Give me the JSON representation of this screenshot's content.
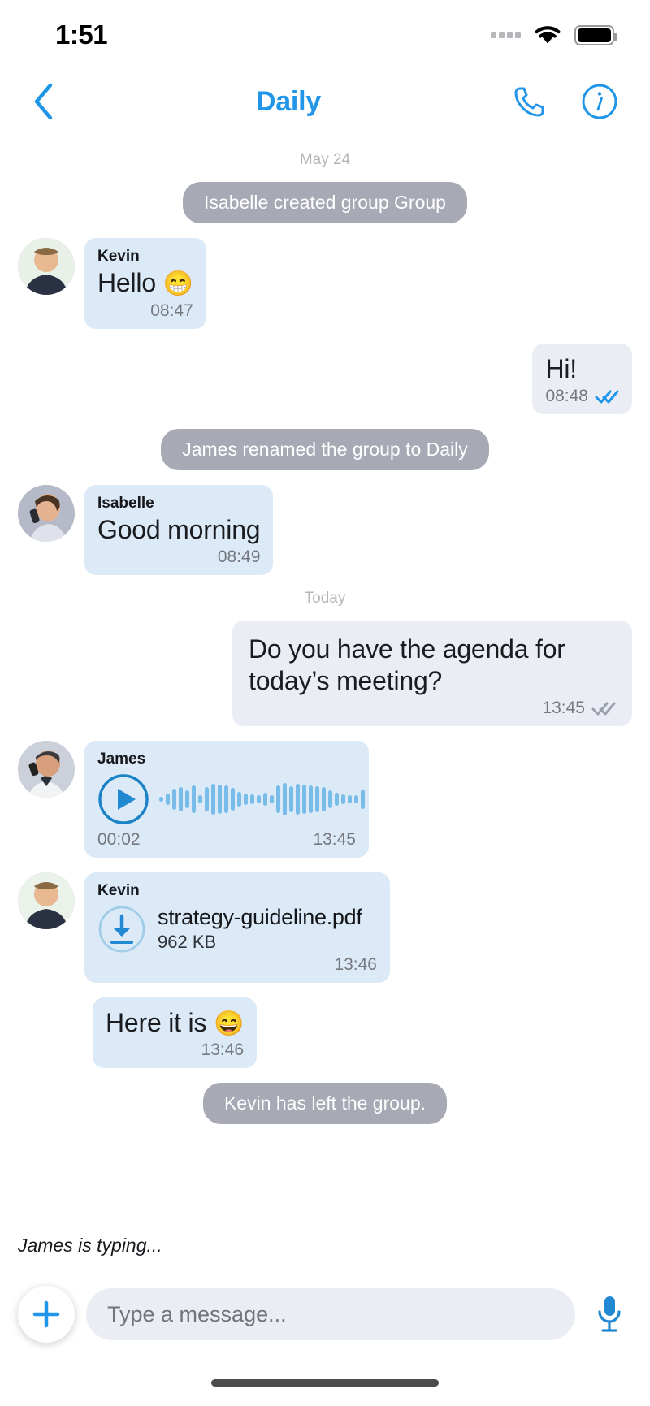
{
  "status_bar": {
    "time": "1:51",
    "signal_icon": "signal-dots-icon",
    "wifi_icon": "wifi-icon",
    "battery_icon": "battery-icon"
  },
  "nav": {
    "back_icon": "chevron-left-icon",
    "title": "Daily",
    "call_icon": "phone-icon",
    "info_icon": "info-circle-icon"
  },
  "chat": {
    "day_separators": {
      "first": "May 24",
      "second": "Today"
    },
    "system_messages": {
      "created": "Isabelle created group Group",
      "renamed": "James renamed the group to Daily",
      "left": "Kevin has left the group."
    },
    "messages": [
      {
        "id": "kevin-hello",
        "sender": "Kevin",
        "text": "Hello",
        "emoji": "😁",
        "time": "08:47",
        "direction": "in",
        "type": "text"
      },
      {
        "id": "me-hi",
        "sender": "",
        "text": "Hi!",
        "time": "08:48",
        "direction": "out",
        "type": "text",
        "status": "read"
      },
      {
        "id": "isabelle-good-morning",
        "sender": "Isabelle",
        "text": "Good morning",
        "time": "08:49",
        "direction": "in",
        "type": "text"
      },
      {
        "id": "me-agenda",
        "sender": "",
        "text": "Do you have the agenda for today’s meeting?",
        "time": "13:45",
        "direction": "out",
        "type": "text",
        "status": "read"
      },
      {
        "id": "james-voice",
        "sender": "James",
        "type": "voice",
        "duration": "00:02",
        "time": "13:45",
        "direction": "in",
        "play_icon": "play-circle-icon"
      },
      {
        "id": "kevin-file",
        "sender": "Kevin",
        "type": "file",
        "file_name": "strategy-guideline.pdf",
        "file_size": "962 KB",
        "time": "13:46",
        "direction": "in",
        "download_icon": "download-circle-icon"
      },
      {
        "id": "kevin-here-it-is",
        "sender": "",
        "text": "Here it is",
        "emoji": "😄",
        "time": "13:46",
        "direction": "in",
        "type": "text"
      }
    ]
  },
  "footer": {
    "typing_indicator": "James is typing...",
    "add_icon": "plus-icon",
    "input_placeholder": "Type a message...",
    "input_value": "",
    "mic_icon": "microphone-icon",
    "home_indicator": "home-indicator"
  },
  "colors": {
    "accent": "#2196e8",
    "incoming_bubble": "#dbeaf6",
    "outgoing_bubble": "#ebedf4",
    "system_pill": "#a7a9b4",
    "waveform": "#78bdea",
    "meta_text": "#76787f"
  },
  "waveform_bars": [
    6,
    14,
    26,
    30,
    22,
    34,
    10,
    30,
    38,
    36,
    34,
    28,
    18,
    14,
    12,
    10,
    16,
    10,
    34,
    40,
    32,
    38,
    36,
    34,
    32,
    30,
    22,
    16,
    12,
    10,
    10,
    24
  ]
}
